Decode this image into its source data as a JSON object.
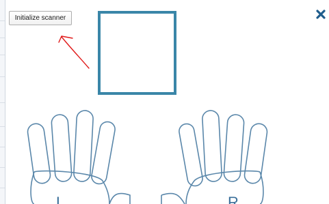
{
  "toolbar": {
    "init_scanner_label": "Initialize scanner"
  },
  "window": {
    "close_icon": "close-icon"
  },
  "hands": {
    "left_label": "L",
    "right_label": "R"
  },
  "colors": {
    "accent": "#3a86a8",
    "annotation": "#e01a1a",
    "hand_outline": "#5a87aa"
  }
}
